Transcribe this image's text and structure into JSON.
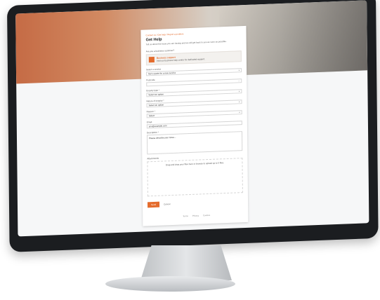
{
  "screen": {
    "form": {
      "breadcrumb": "Contact us / Get help / Report a problem",
      "title": "Get Help",
      "intro": "Tell us about the issue you are having and we will get back to you as soon as possible.",
      "section_label": "Are you a business customer?",
      "alert": {
        "title": "Business support",
        "text": "Visit our business help centre for dedicated support."
      },
      "fields": [
        {
          "label": "Select a service",
          "value": "Get a quote for a new service",
          "type": "select"
        },
        {
          "label": "Postcode",
          "value": "",
          "type": "input"
        },
        {
          "label": "Enquiry type *",
          "value": "Select an option",
          "type": "select"
        },
        {
          "label": "Nature of enquiry *",
          "value": "Select an option",
          "type": "select"
        },
        {
          "label": "Reason *",
          "value": "Select",
          "type": "select"
        },
        {
          "label": "Email",
          "value": "you@example.com",
          "type": "input"
        }
      ],
      "details": {
        "label": "Description *",
        "placeholder": "Please describe your issue..."
      },
      "upload": {
        "label": "Attachments",
        "text": "Drag and drop your files here or browse to upload up to 5 files."
      },
      "submit_label": "Send",
      "cancel_label": "Cancel"
    },
    "footer": [
      "Terms",
      "Privacy",
      "Cookies"
    ]
  }
}
